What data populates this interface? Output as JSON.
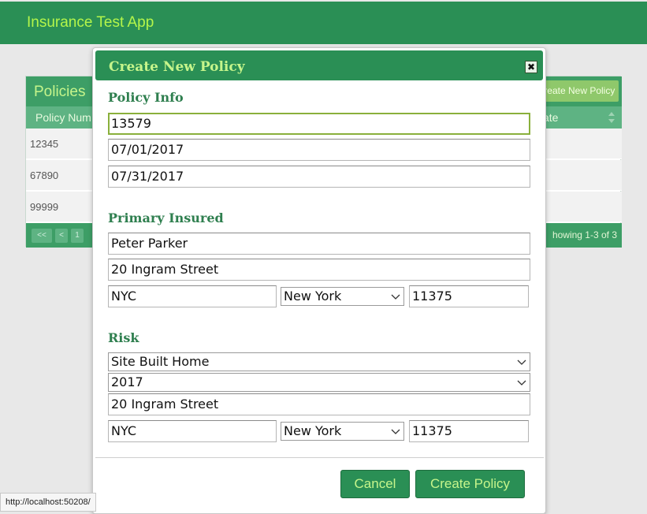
{
  "app": {
    "title": "Insurance Test App"
  },
  "policies": {
    "title": "Policies",
    "create_button": "Create New Policy",
    "columns": [
      "Policy Num",
      "ate"
    ],
    "rows": [
      "12345",
      "67890",
      "99999"
    ],
    "pager": {
      "first": "<<",
      "prev": "<",
      "page": "1",
      "showing": "howing 1-3 of 3"
    }
  },
  "modal": {
    "title": "Create New Policy",
    "close_icon": "close-icon",
    "policy_info": {
      "title": "Policy Info",
      "policy_number": "13579",
      "effective_date": "07/01/2017",
      "expiration_date": "07/31/2017"
    },
    "primary_insured": {
      "title": "Primary Insured",
      "name": "Peter Parker",
      "street": "20 Ingram Street",
      "city": "NYC",
      "state": "New York",
      "zip": "11375"
    },
    "risk": {
      "title": "Risk",
      "construction_type": "Site Built Home",
      "year": "2017",
      "street": "20 Ingram Street",
      "city": "NYC",
      "state": "New York",
      "zip": "11375"
    },
    "buttons": {
      "cancel": "Cancel",
      "create": "Create Policy"
    }
  },
  "status_bar": {
    "url": "http://localhost:50208/"
  },
  "colors": {
    "brand_green": "#2a8f55",
    "accent_lime": "#c6f58b",
    "focus_border": "#8ab03c"
  }
}
